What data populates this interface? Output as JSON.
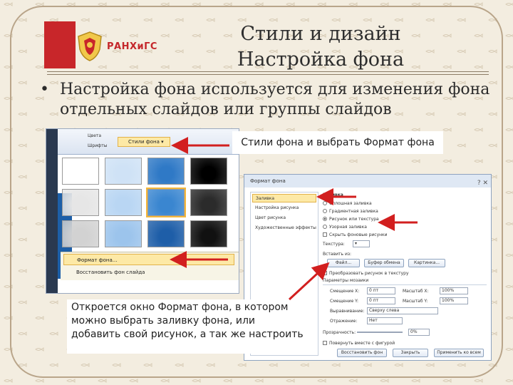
{
  "header": {
    "logo_text": "РАНХиГС",
    "title_line1": "Стили и дизайн",
    "title_line2": "Настройка фона"
  },
  "bullet": {
    "marker": "•",
    "text": "Настройка фона используется для изменения фона отдельных слайдов или группы слайдов"
  },
  "captions": {
    "styles": "Стили фона и выбрать Формат фона",
    "dialog_note": "Откроется окно Формат фона, в котором можно выбрать заливку фона, или добавить свой рисунок, а так же настроить"
  },
  "gallery": {
    "ribbon_colors": "Цвета",
    "ribbon_fonts": "Шрифты",
    "styles_button": "Стили фона",
    "menu_format": "Формат фона...",
    "menu_reset": "Восстановить фон слайда",
    "thumb_fills": [
      "#ffffff",
      "#cfe2f6",
      "#2f79c6",
      "#000000",
      "#e6e6e6",
      "#b9d6f3",
      "#3a86d0",
      "#2b2b2b",
      "#d2d2d2",
      "#9cc4ec",
      "#1e5ea8",
      "#111111"
    ]
  },
  "dialog": {
    "title": "Формат фона",
    "close": "?  ✕",
    "left_items": [
      "Заливка",
      "Настройка рисунка",
      "Цвет рисунка",
      "Художественные эффекты"
    ],
    "section_fill": "Заливка",
    "options": [
      "Сплошная заливка",
      "Градиентная заливка",
      "Рисунок или текстура",
      "Узорная заливка"
    ],
    "hide_graphics": "Скрыть фоновые рисунки",
    "texture_label": "Текстура:",
    "insert_from": "Вставить из:",
    "btn_file": "Файл...",
    "btn_clipboard": "Буфер обмена",
    "btn_clip": "Картинка...",
    "tile_checkbox": "Преобразовать рисунок в текстуру",
    "tile_options": "Параметры мозаики",
    "offset_x_label": "Смещение X:",
    "offset_x": "0 пт",
    "offset_y_label": "Смещение Y:",
    "offset_y": "0 пт",
    "scale_x_label": "Масштаб X:",
    "scale_x": "100%",
    "scale_y_label": "Масштаб Y:",
    "scale_y": "100%",
    "align_label": "Выравнивание:",
    "align_value": "Сверху слева",
    "mirror_label": "Отражение:",
    "mirror_value": "Нет",
    "transparency_label": "Прозрачность:",
    "transparency_value": "0%",
    "rotate_checkbox": "Повернуть вместе с фигурой",
    "btn_reset": "Восстановить фон",
    "btn_close": "Закрыть",
    "btn_apply_all": "Применить ко всем"
  },
  "colors": {
    "accent_red": "#c8262a",
    "arrow_red": "#d21f1f",
    "selection": "#fde9a6"
  }
}
